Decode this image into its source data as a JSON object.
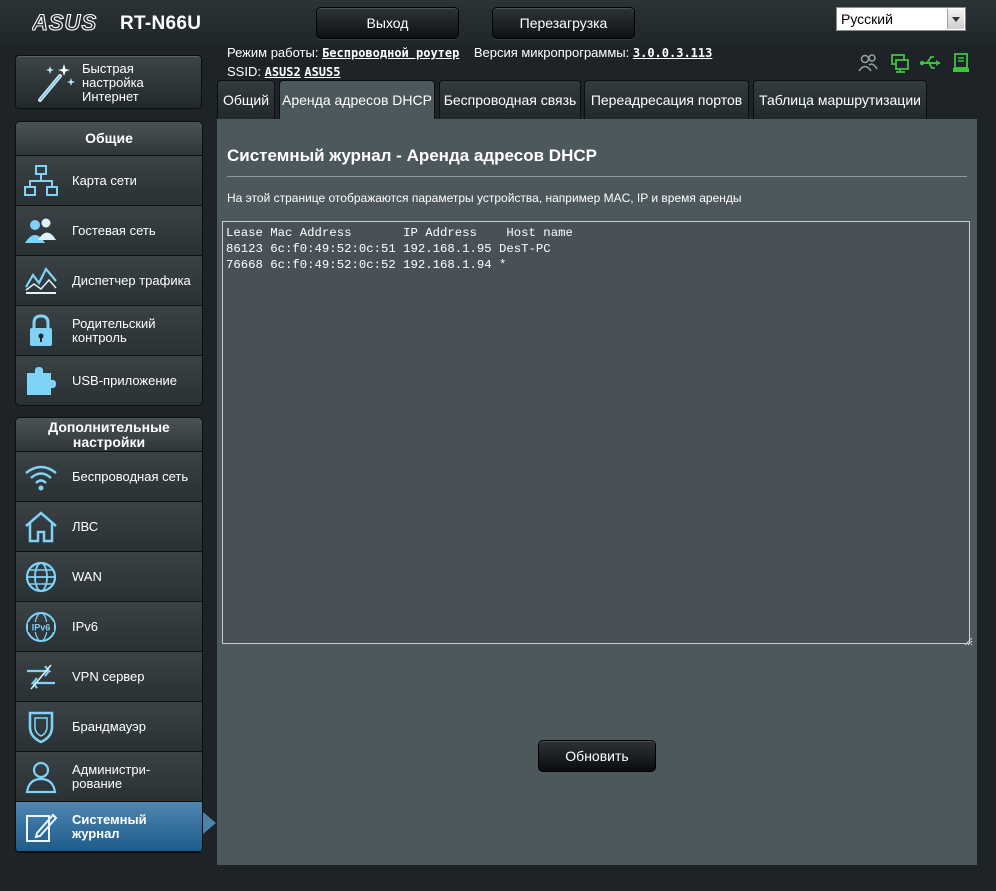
{
  "header": {
    "brand": "ASUS",
    "model": "RT-N66U",
    "logout_label": "Выход",
    "reboot_label": "Перезагрузка",
    "language_selected": "Русский"
  },
  "info": {
    "mode_label": "Режим работы:",
    "mode_value": "Беспроводной роутер",
    "firmware_label": "Версия микропрограммы:",
    "firmware_value": "3.0.0.3.113",
    "ssid_label": "SSID:",
    "ssid_1": "ASUS2",
    "ssid_2": "ASUS5"
  },
  "sidebar": {
    "quick_setup": "Быстрая настройка Интернет",
    "general_title": "Общие",
    "general_items": [
      {
        "label": "Карта сети"
      },
      {
        "label": "Гостевая сеть"
      },
      {
        "label": "Диспетчер трафика"
      },
      {
        "label": "Родительский контроль"
      },
      {
        "label": "USB-приложение"
      }
    ],
    "advanced_title": "Дополнительные настройки",
    "advanced_items": [
      {
        "label": "Беспроводная сеть"
      },
      {
        "label": "ЛВС"
      },
      {
        "label": "WAN"
      },
      {
        "label": "IPv6"
      },
      {
        "label": "VPN сервер"
      },
      {
        "label": "Брандмауэр"
      },
      {
        "label": "Администри-рование"
      },
      {
        "label": "Системный журнал"
      }
    ]
  },
  "tabs": [
    {
      "label": "Общий"
    },
    {
      "label": "Аренда адресов DHCP"
    },
    {
      "label": "Беспроводная связь"
    },
    {
      "label": "Переадресация портов"
    },
    {
      "label": "Таблица маршрутизации"
    }
  ],
  "content": {
    "title": "Системный журнал - Аренда адресов DHCP",
    "description": "На этой странице отображаются параметры устройства, например MAC, IP и время аренды",
    "log_text": "Lease Mac Address       IP Address    Host name\n86123 6c:f0:49:52:0c:51 192.168.1.95 DesT-PC\n76668 6c:f0:49:52:0c:52 192.168.1.94 *",
    "refresh_label": "Обновить"
  },
  "colors": {
    "active_blue": "#1d5c8b",
    "status_green": "#3ec53e",
    "panel": "#4d585c"
  }
}
